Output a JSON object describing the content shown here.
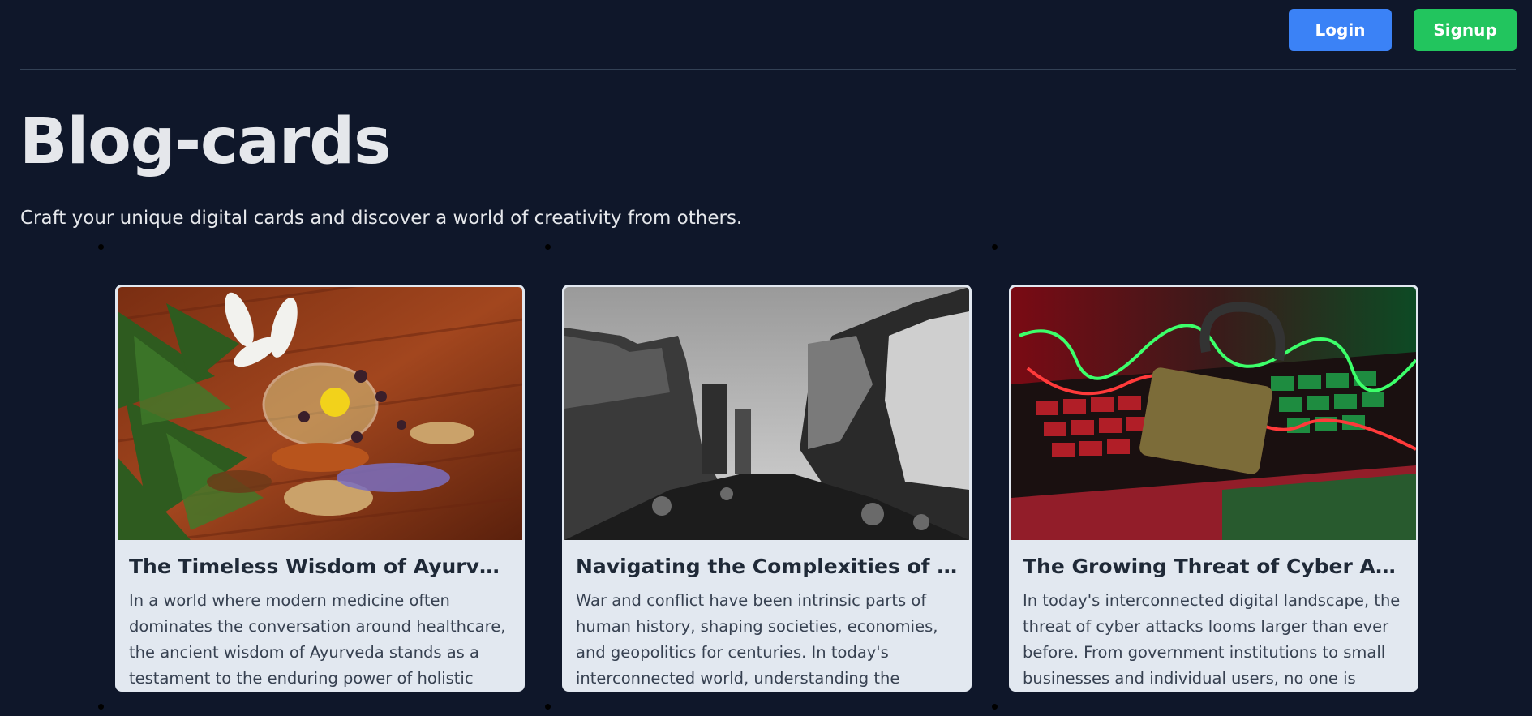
{
  "header": {
    "login_label": "Login",
    "signup_label": "Signup"
  },
  "hero": {
    "title": "Blog-cards",
    "subtitle": "Craft your unique digital cards and discover a world of creativity from others."
  },
  "cards": [
    {
      "title": "The Timeless Wisdom of Ayurveda: ...",
      "excerpt": "In a world where modern medicine often dominates the conversation around healthcare, the ancient wisdom of Ayurveda stands as a testament to the enduring power of holistic"
    },
    {
      "title": "Navigating the Complexities of War ...",
      "excerpt": "War and conflict have been intrinsic parts of human history, shaping societies, economies, and geopolitics for centuries. In today's interconnected world, understanding the"
    },
    {
      "title": "The Growing Threat of Cyber Attacks...",
      "excerpt": "In today's interconnected digital landscape, the threat of cyber attacks looms larger than ever before. From government institutions to small businesses and individual users, no one is"
    }
  ],
  "colors": {
    "background": "#0f172a",
    "login": "#3b82f6",
    "signup": "#22c55e",
    "card": "#e2e8f0"
  }
}
